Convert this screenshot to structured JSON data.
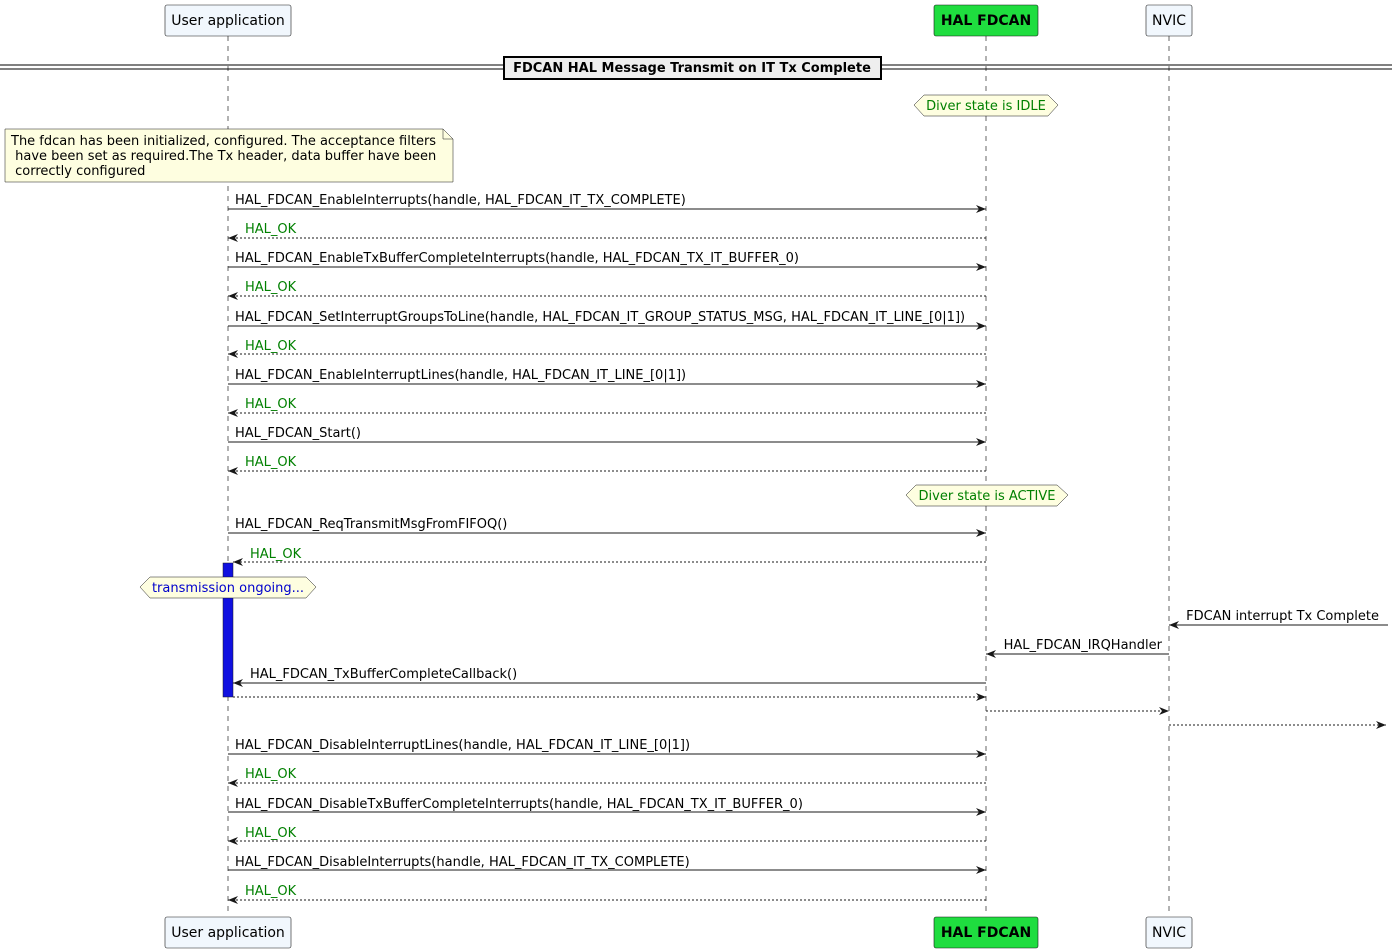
{
  "participants": {
    "user_app": {
      "label": "User application",
      "fill": "#f1f7fd"
    },
    "hal_fdcan": {
      "label": "HAL FDCAN",
      "fill": "#1fdd3f"
    },
    "nvic": {
      "label": "NVIC",
      "fill": "#f1f7fd"
    }
  },
  "divider": {
    "label": "FDCAN HAL Message Transmit on IT Tx Complete"
  },
  "states": {
    "idle": "Diver state is IDLE",
    "active": "Diver state is ACTIVE",
    "transmission": "transmission ongoing..."
  },
  "note": {
    "line1": "The fdcan has been initialized, configured. The acceptance filters",
    "line2": " have been set as required.The Tx header, data buffer have been",
    "line3": " correctly configured"
  },
  "messages": {
    "m1": "HAL_FDCAN_EnableInterrupts(handle, HAL_FDCAN_IT_TX_COMPLETE)",
    "m2": "HAL_FDCAN_EnableTxBufferCompleteInterrupts(handle, HAL_FDCAN_TX_IT_BUFFER_0)",
    "m3": "HAL_FDCAN_SetInterruptGroupsToLine(handle, HAL_FDCAN_IT_GROUP_STATUS_MSG, HAL_FDCAN_IT_LINE_[0|1])",
    "m4": "HAL_FDCAN_EnableInterruptLines(handle, HAL_FDCAN_IT_LINE_[0|1])",
    "m5": "HAL_FDCAN_Start()",
    "m6": "HAL_FDCAN_ReqTransmitMsgFromFIFOQ()",
    "irq_in": "FDCAN interrupt Tx Complete",
    "irq_handler": "HAL_FDCAN_IRQHandler",
    "callback": "HAL_FDCAN_TxBufferCompleteCallback()",
    "m7": "HAL_FDCAN_DisableInterruptLines(handle, HAL_FDCAN_IT_LINE_[0|1])",
    "m8": "HAL_FDCAN_DisableTxBufferCompleteInterrupts(handle, HAL_FDCAN_TX_IT_BUFFER_0)",
    "m9": "HAL_FDCAN_DisableInterrupts(handle, HAL_FDCAN_IT_TX_COMPLETE)"
  },
  "return_label": "HAL_OK",
  "colors": {
    "activation": "#1010e0",
    "state_fill": "#fefee0",
    "note_fill": "#fefee0",
    "return_text": "#008000"
  }
}
